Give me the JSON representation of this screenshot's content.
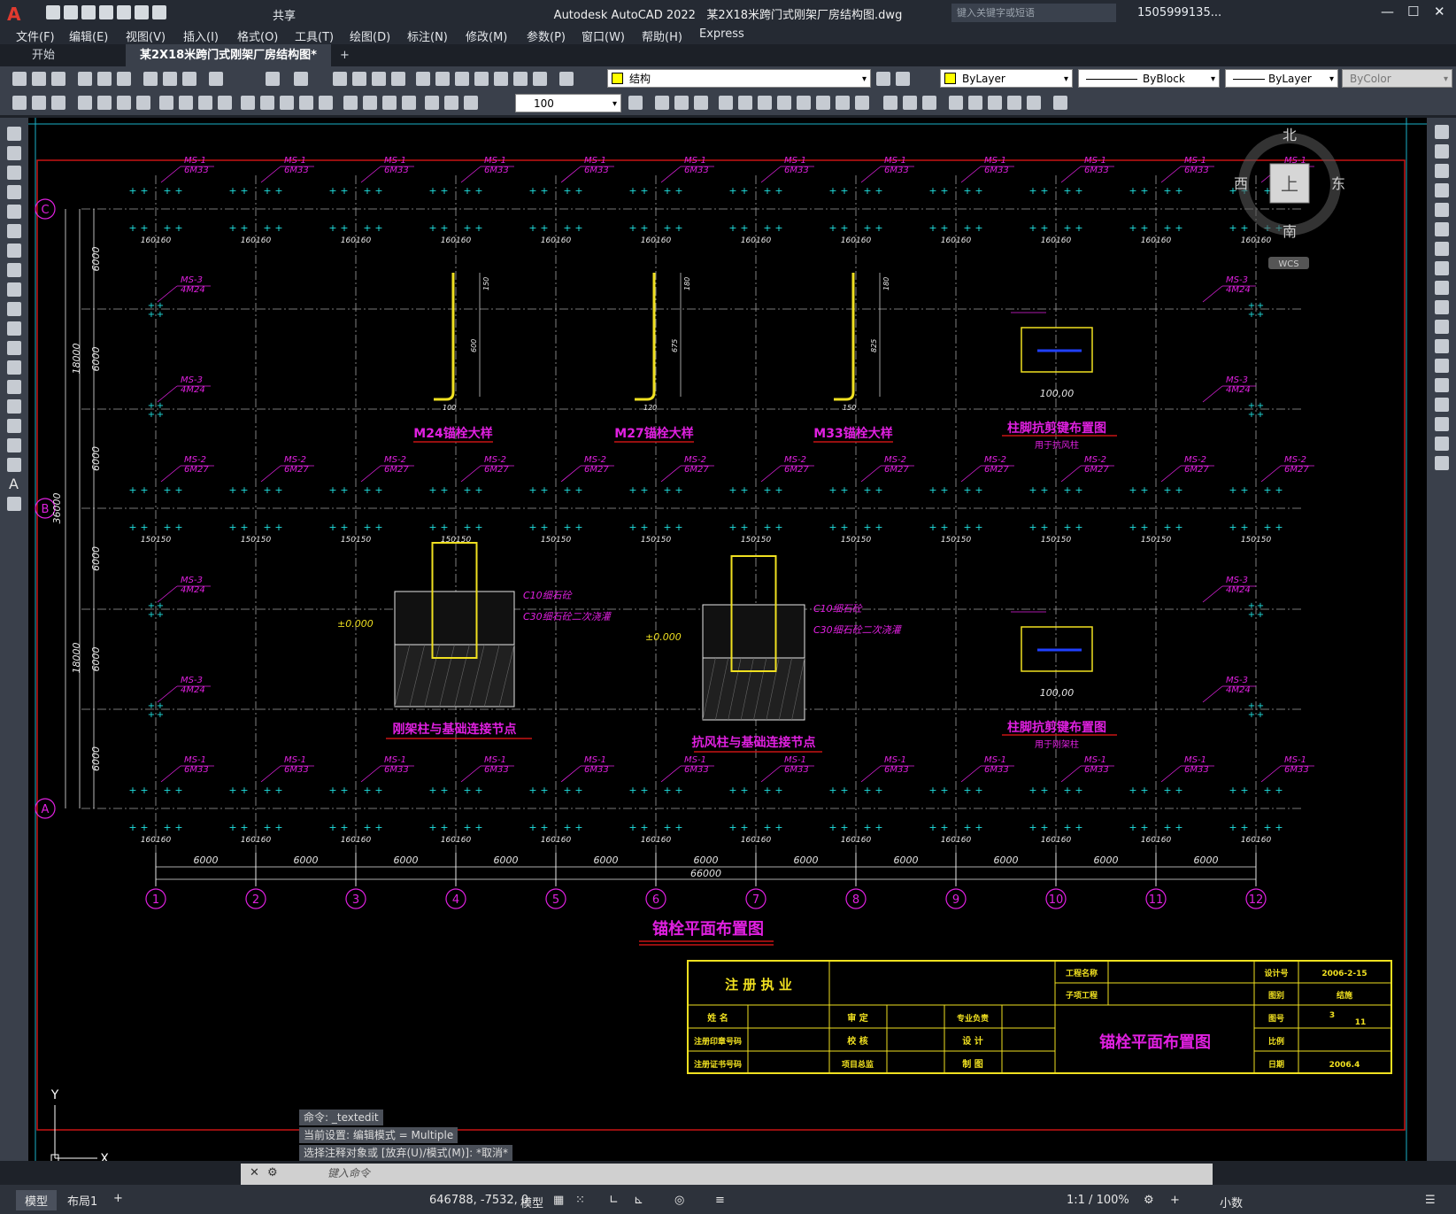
{
  "app": {
    "title": "Autodesk AutoCAD 2022",
    "file": "某2X18米跨门式刚架厂房结构图.dwg",
    "search_placeholder": "键入关键字或短语",
    "user": "1505999135...",
    "share": "共享"
  },
  "menu": [
    "文件(F)",
    "编辑(E)",
    "视图(V)",
    "插入(I)",
    "格式(O)",
    "工具(T)",
    "绘图(D)",
    "标注(N)",
    "修改(M)",
    "参数(P)",
    "窗口(W)",
    "帮助(H)",
    "Express"
  ],
  "tabs": [
    "开始",
    "某2X18米跨门式刚架厂房结构图*"
  ],
  "toolbar": {
    "layer": "结构",
    "color": "ByLayer",
    "linetype": "ByBlock",
    "lineweight": "ByLayer",
    "plotstyle": "ByColor",
    "scale": "100"
  },
  "viewcube": {
    "north": "北",
    "south": "南",
    "east": "东",
    "west": "西",
    "top": "上",
    "wcs": "WCS"
  },
  "drawing": {
    "col_axes": [
      "1",
      "2",
      "3",
      "4",
      "5",
      "6",
      "7",
      "8",
      "9",
      "10",
      "11",
      "12"
    ],
    "row_axes": [
      "C",
      "B",
      "A"
    ],
    "span_dims": [
      "6000",
      "6000",
      "6000",
      "6000",
      "6000",
      "6000",
      "6000",
      "6000",
      "6000",
      "6000",
      "6000"
    ],
    "total_dim": "66000",
    "left_dims": [
      "6000",
      "6000",
      "6000",
      "6000",
      "6000",
      "6000"
    ],
    "left_sub": [
      "18000",
      "18000"
    ],
    "left_total": "36000",
    "ms1": [
      "MS-1",
      "6M33"
    ],
    "ms2": [
      "MS-2",
      "6M27"
    ],
    "ms3": [
      "MS-3",
      "4M24"
    ],
    "dim_pair_top": "160160",
    "dim_pair_mid": "150150",
    "detail_m24": "M24锚栓大样",
    "detail_m27": "M27锚栓大样",
    "detail_m33": "M33锚栓大样",
    "shear1": "柱脚抗剪键布置图",
    "shear1_sub": "用于抗风柱",
    "shear2": "柱脚抗剪键布置图",
    "shear2_sub": "用于刚架柱",
    "node1": "刚架柱与基础连接节点",
    "node2": "抗风柱与基础连接节点",
    "c10": "C10细石砼",
    "c30": "C30细石砼二次浇灌",
    "elev": "±0.000",
    "plan_title": "锚栓平面布置图"
  },
  "title_block": {
    "reg": "注 册 执 业",
    "project_name": "工程名称",
    "sub_project": "子项工程",
    "designer_no": "设计号",
    "date_code": "2006-2-15",
    "drawing_cat": "图别",
    "cat_val": "结施",
    "drawing_no": "图号",
    "no_val": "3",
    "no_total": "11",
    "scale": "比例",
    "date": "日期",
    "date_val": "2006.4",
    "name": "姓 名",
    "cert_no": "注册印章号码",
    "reg_no": "注册证书号码",
    "review": "审 定",
    "check": "校 核",
    "proj_lead": "项目总监",
    "spec_lead": "专业负责",
    "design": "设 计",
    "draw": "制 图",
    "title": "锚栓平面布置图"
  },
  "command": {
    "line1": "命令: _textedit",
    "line2": "当前设置: 编辑模式 = Multiple",
    "line3": "选择注释对象或 [放弃(U)/模式(M)]: *取消*",
    "placeholder": "键入命令"
  },
  "status": {
    "model_tab": "模型",
    "layout_tab": "布局1",
    "coords": "646788, -7532, 0",
    "model": "模型",
    "scale": "1:1 / 100%",
    "units": "小数"
  }
}
